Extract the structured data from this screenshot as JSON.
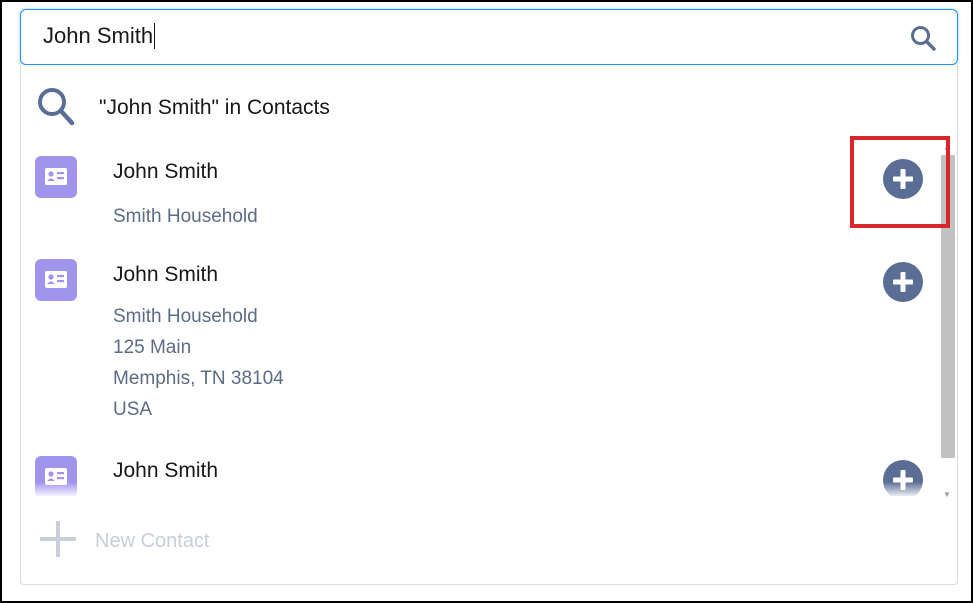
{
  "search": {
    "value": "John Smith",
    "icon": "search-icon"
  },
  "dropdown": {
    "search_in_label": "\"John Smith\" in Contacts",
    "search_in_icon": "search-icon",
    "results": [
      {
        "title": "John Smith",
        "meta": [
          "Smith Household"
        ],
        "icon": "contact-card-icon",
        "action_icon": "add-circle-icon"
      },
      {
        "title": "John Smith",
        "meta": [
          "Smith Household",
          "125 Main",
          "Memphis, TN 38104",
          "USA"
        ],
        "icon": "contact-card-icon",
        "action_icon": "add-circle-icon"
      },
      {
        "title": "John Smith",
        "meta": [],
        "icon": "contact-card-icon",
        "action_icon": "add-circle-icon"
      }
    ],
    "new_contact_label": "New Contact",
    "new_contact_icon": "plus-icon"
  },
  "colors": {
    "focus_border": "#1b96ff",
    "contact_icon_bg": "#a094ed",
    "add_button_bg": "#5a6e95",
    "meta_text": "#5c6b86",
    "disabled_text": "#c9ced8",
    "highlight": "#d62828"
  }
}
